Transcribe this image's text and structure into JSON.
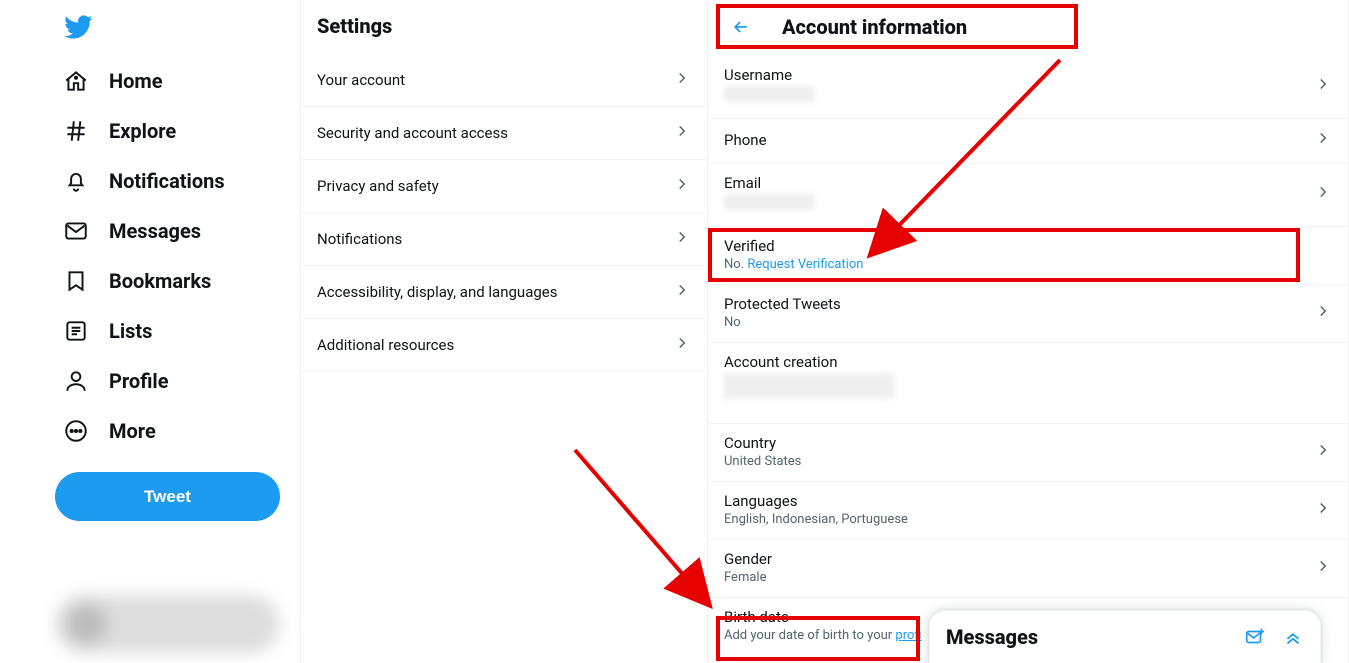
{
  "nav": {
    "items": [
      {
        "label": "Home"
      },
      {
        "label": "Explore"
      },
      {
        "label": "Notifications"
      },
      {
        "label": "Messages"
      },
      {
        "label": "Bookmarks"
      },
      {
        "label": "Lists"
      },
      {
        "label": "Profile"
      },
      {
        "label": "More"
      }
    ],
    "tweet_button": "Tweet"
  },
  "settings": {
    "title": "Settings",
    "items": [
      {
        "label": "Your account"
      },
      {
        "label": "Security and account access"
      },
      {
        "label": "Privacy and safety"
      },
      {
        "label": "Notifications"
      },
      {
        "label": "Accessibility, display, and languages"
      },
      {
        "label": "Additional resources"
      }
    ]
  },
  "detail": {
    "title": "Account information",
    "rows": {
      "username": {
        "label": "Username",
        "value": ""
      },
      "phone": {
        "label": "Phone"
      },
      "email": {
        "label": "Email",
        "value": ""
      },
      "verified": {
        "label": "Verified",
        "status": "No. ",
        "link": "Request Verification"
      },
      "protected": {
        "label": "Protected Tweets",
        "value": "No"
      },
      "creation": {
        "label": "Account creation",
        "value": ""
      },
      "country": {
        "label": "Country",
        "value": "United States"
      },
      "languages": {
        "label": "Languages",
        "value": "English, Indonesian, Portuguese"
      },
      "gender": {
        "label": "Gender",
        "value": "Female"
      },
      "birth": {
        "label": "Birth date",
        "hint_pre": "Add your date of birth to your ",
        "hint_link": "profi"
      }
    }
  },
  "dm": {
    "title": "Messages"
  }
}
